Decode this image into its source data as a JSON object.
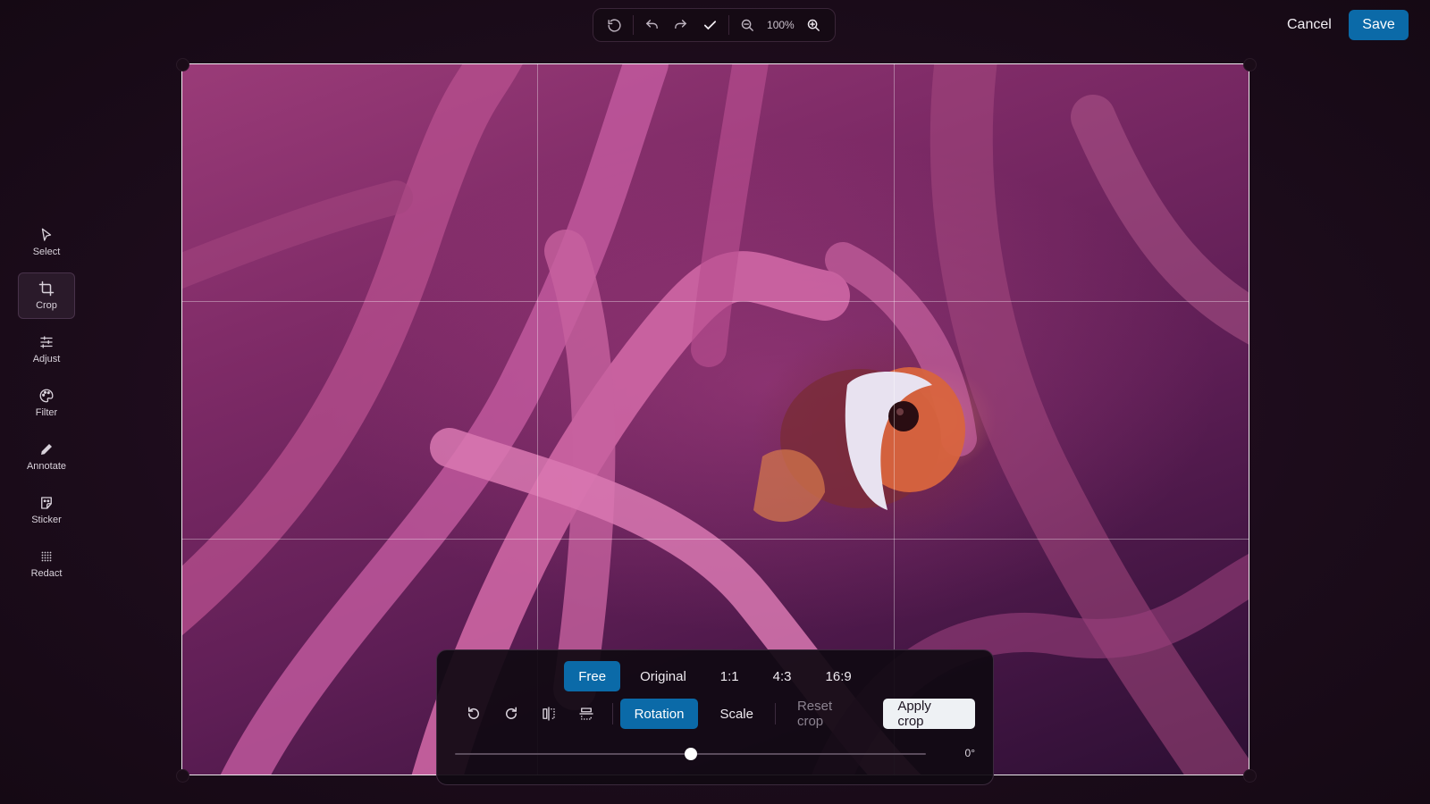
{
  "toolbar": {
    "reset_icon": "reset-icon",
    "undo_icon": "undo-icon",
    "redo_icon": "redo-icon",
    "confirm_icon": "checkmark-icon",
    "zoom_out_icon": "zoom-out-icon",
    "zoom_level": "100%",
    "zoom_in_icon": "zoom-in-icon"
  },
  "actions": {
    "cancel_label": "Cancel",
    "save_label": "Save"
  },
  "rail": {
    "items": [
      {
        "label": "Select",
        "icon": "cursor-icon",
        "active": false
      },
      {
        "label": "Crop",
        "icon": "crop-icon",
        "active": true
      },
      {
        "label": "Adjust",
        "icon": "sliders-icon",
        "active": false
      },
      {
        "label": "Filter",
        "icon": "palette-icon",
        "active": false
      },
      {
        "label": "Annotate",
        "icon": "pencil-icon",
        "active": false
      },
      {
        "label": "Sticker",
        "icon": "sticker-icon",
        "active": false
      },
      {
        "label": "Redact",
        "icon": "redact-dots-icon",
        "active": false
      }
    ]
  },
  "crop_panel": {
    "ratios": [
      "Free",
      "Original",
      "1:1",
      "4:3",
      "16:9"
    ],
    "active_ratio": "Free",
    "tools": [
      "rotate-left-icon",
      "rotate-right-icon",
      "flip-horizontal-icon",
      "flip-vertical-icon"
    ],
    "modes": [
      "Rotation",
      "Scale"
    ],
    "active_mode": "Rotation",
    "reset_label": "Reset crop",
    "apply_label": "Apply crop",
    "rotation_value": "0°",
    "rotation_fraction": 0.5
  },
  "colors": {
    "accent": "#0b6aa8",
    "background": "#1c0c1b"
  }
}
